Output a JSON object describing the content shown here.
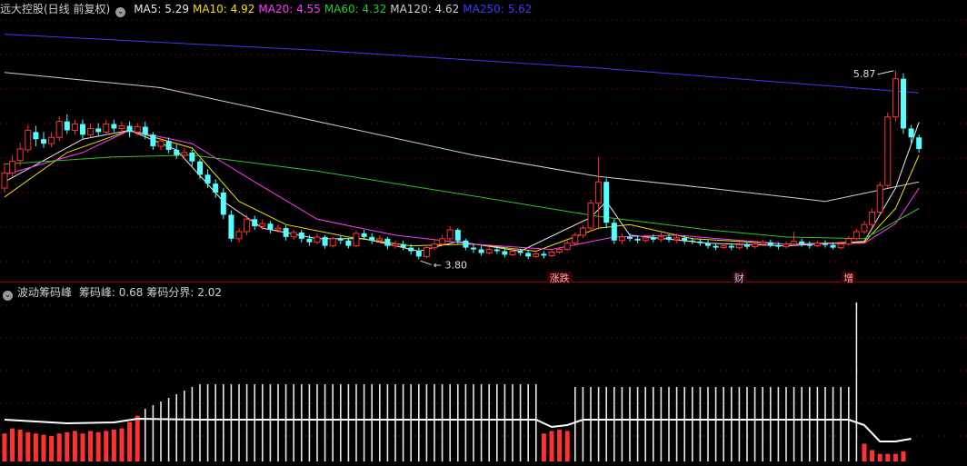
{
  "stock": {
    "title": "远大控股(日线 前复权)",
    "ma_items": [
      {
        "label": "MA5: ",
        "value": "5.29",
        "color": "#e8e8e8"
      },
      {
        "label": "MA10: ",
        "value": "4.92",
        "color": "#f0e000"
      },
      {
        "label": "MA20: ",
        "value": "4.55",
        "color": "#ff3cff"
      },
      {
        "label": "MA60: ",
        "value": "4.32",
        "color": "#28c828"
      },
      {
        "label": "MA120: ",
        "value": "4.62",
        "color": "#d0d0d0"
      },
      {
        "label": "MA250: ",
        "value": "5.62",
        "color": "#3a3aff"
      }
    ],
    "max_label": "5.87",
    "min_label": "3.80",
    "event_tags": [
      "涨跌",
      "财",
      "增"
    ],
    "colors": {
      "up": "#ff3232",
      "down": "#54ffff",
      "bg": "#000000",
      "grid": "#6a0000"
    }
  },
  "indicator": {
    "title": "波动筹码峰",
    "items": [
      {
        "label": "筹码峰: ",
        "value": "0.68"
      },
      {
        "label": "筹码分界: ",
        "value": "2.02"
      }
    ]
  },
  "icons": {
    "main_toggle": "chevron-down-icon",
    "sub_toggle": "chevron-down-icon"
  },
  "chart_data": {
    "type": "candlestick",
    "ylim": [
      3.6,
      6.4
    ],
    "candles": [
      [
        4.55,
        4.72,
        4.83,
        4.5
      ],
      [
        4.72,
        4.85,
        4.92,
        4.68
      ],
      [
        4.86,
        4.99,
        5.06,
        4.8
      ],
      [
        4.98,
        5.2,
        5.26,
        4.95
      ],
      [
        5.18,
        5.1,
        5.25,
        5.02
      ],
      [
        5.1,
        5.05,
        5.18,
        5.0
      ],
      [
        5.05,
        5.12,
        5.18,
        5.01
      ],
      [
        5.12,
        5.3,
        5.36,
        5.08
      ],
      [
        5.3,
        5.2,
        5.38,
        5.16
      ],
      [
        5.2,
        5.27,
        5.32,
        5.15
      ],
      [
        5.27,
        5.15,
        5.32,
        5.1
      ],
      [
        5.15,
        5.22,
        5.28,
        5.12
      ],
      [
        5.22,
        5.18,
        5.28,
        5.14
      ],
      [
        5.18,
        5.27,
        5.32,
        5.15
      ],
      [
        5.27,
        5.22,
        5.32,
        5.18
      ],
      [
        5.22,
        5.25,
        5.3,
        5.18
      ],
      [
        5.25,
        5.18,
        5.3,
        5.12
      ],
      [
        5.18,
        5.24,
        5.28,
        5.14
      ],
      [
        5.24,
        5.15,
        5.3,
        5.1
      ],
      [
        5.15,
        5.02,
        5.18,
        4.98
      ],
      [
        5.02,
        5.08,
        5.12,
        4.98
      ],
      [
        5.08,
        4.98,
        5.12,
        4.94
      ],
      [
        4.98,
        4.92,
        5.04,
        4.88
      ],
      [
        4.92,
        4.95,
        5.0,
        4.88
      ],
      [
        4.95,
        4.85,
        4.98,
        4.8
      ],
      [
        4.85,
        4.7,
        4.88,
        4.65
      ],
      [
        4.7,
        4.6,
        4.76,
        4.55
      ],
      [
        4.6,
        4.5,
        4.65,
        4.44
      ],
      [
        4.5,
        4.25,
        4.55,
        4.2
      ],
      [
        4.25,
        3.98,
        4.3,
        3.95
      ],
      [
        3.98,
        4.06,
        4.1,
        3.94
      ],
      [
        4.06,
        4.2,
        4.25,
        4.02
      ],
      [
        4.2,
        4.12,
        4.24,
        4.08
      ],
      [
        4.12,
        4.15,
        4.2,
        4.08
      ],
      [
        4.15,
        4.08,
        4.18,
        4.04
      ],
      [
        4.08,
        4.1,
        4.14,
        4.05
      ],
      [
        4.1,
        4.0,
        4.13,
        3.96
      ],
      [
        4.0,
        4.05,
        4.08,
        3.97
      ],
      [
        4.05,
        3.98,
        4.08,
        3.94
      ],
      [
        3.98,
        3.94,
        4.02,
        3.9
      ],
      [
        3.94,
        4.0,
        4.04,
        3.92
      ],
      [
        4.0,
        3.9,
        4.02,
        3.87
      ],
      [
        3.9,
        3.98,
        4.0,
        3.88
      ],
      [
        3.98,
        3.96,
        4.02,
        3.92
      ],
      [
        3.96,
        3.9,
        3.99,
        3.87
      ],
      [
        3.9,
        4.04,
        4.07,
        3.88
      ],
      [
        4.04,
        4.0,
        4.08,
        3.97
      ],
      [
        4.0,
        3.96,
        4.04,
        3.92
      ],
      [
        3.96,
        3.98,
        4.02,
        3.93
      ],
      [
        3.98,
        3.9,
        4.0,
        3.86
      ],
      [
        3.9,
        3.92,
        3.96,
        3.87
      ],
      [
        3.92,
        3.88,
        3.96,
        3.85
      ],
      [
        3.88,
        3.84,
        3.92,
        3.8
      ],
      [
        3.84,
        3.78,
        3.88,
        3.75
      ],
      [
        3.78,
        3.88,
        3.91,
        3.76
      ],
      [
        3.88,
        3.92,
        3.96,
        3.85
      ],
      [
        3.92,
        3.98,
        4.02,
        3.9
      ],
      [
        3.98,
        4.08,
        4.12,
        3.96
      ],
      [
        4.08,
        3.96,
        4.1,
        3.92
      ],
      [
        3.96,
        3.88,
        3.98,
        3.85
      ],
      [
        3.88,
        3.86,
        3.92,
        3.82
      ],
      [
        3.86,
        3.82,
        3.9,
        3.79
      ],
      [
        3.82,
        3.86,
        3.89,
        3.8
      ],
      [
        3.86,
        3.84,
        3.89,
        3.81
      ],
      [
        3.84,
        3.8,
        3.87,
        3.77
      ],
      [
        3.8,
        3.84,
        3.88,
        3.78
      ],
      [
        3.84,
        3.82,
        3.87,
        3.79
      ],
      [
        3.82,
        3.78,
        3.85,
        3.75
      ],
      [
        3.78,
        3.81,
        3.84,
        3.76
      ],
      [
        3.81,
        3.79,
        3.84,
        3.76
      ],
      [
        3.79,
        3.83,
        3.86,
        3.77
      ],
      [
        3.83,
        3.86,
        3.89,
        3.81
      ],
      [
        3.86,
        3.93,
        3.96,
        3.84
      ],
      [
        3.93,
        4.02,
        4.05,
        3.9
      ],
      [
        4.02,
        4.1,
        4.13,
        3.99
      ],
      [
        4.1,
        4.38,
        4.42,
        4.06
      ],
      [
        4.38,
        4.62,
        4.9,
        4.1
      ],
      [
        4.62,
        4.16,
        4.66,
        4.1
      ],
      [
        4.16,
        3.96,
        4.2,
        3.92
      ],
      [
        3.96,
        4.0,
        4.04,
        3.92
      ],
      [
        4.0,
        3.98,
        4.04,
        3.95
      ],
      [
        3.98,
        3.96,
        4.02,
        3.93
      ],
      [
        3.96,
        3.99,
        4.03,
        3.94
      ],
      [
        3.99,
        3.97,
        4.03,
        3.94
      ],
      [
        3.97,
        4.0,
        4.05,
        3.94
      ],
      [
        4.0,
        3.97,
        4.03,
        3.94
      ],
      [
        3.97,
        3.99,
        4.04,
        3.93
      ],
      [
        3.99,
        3.96,
        4.02,
        3.92
      ],
      [
        3.96,
        3.95,
        3.99,
        3.92
      ],
      [
        3.95,
        3.93,
        3.98,
        3.9
      ],
      [
        3.93,
        3.9,
        3.96,
        3.87
      ],
      [
        3.9,
        3.88,
        3.93,
        3.85
      ],
      [
        3.88,
        3.9,
        3.93,
        3.86
      ],
      [
        3.9,
        3.88,
        3.93,
        3.85
      ],
      [
        3.88,
        3.91,
        3.94,
        3.86
      ],
      [
        3.91,
        3.89,
        3.94,
        3.86
      ],
      [
        3.89,
        3.92,
        3.95,
        3.87
      ],
      [
        3.92,
        3.94,
        3.97,
        3.9
      ],
      [
        3.94,
        3.91,
        3.97,
        3.88
      ],
      [
        3.91,
        3.89,
        3.94,
        3.86
      ],
      [
        3.89,
        3.92,
        3.95,
        3.87
      ],
      [
        3.92,
        3.95,
        4.06,
        3.9
      ],
      [
        3.95,
        3.92,
        3.98,
        3.89
      ],
      [
        3.92,
        3.9,
        3.95,
        3.87
      ],
      [
        3.9,
        3.93,
        3.96,
        3.88
      ],
      [
        3.93,
        3.91,
        3.96,
        3.88
      ],
      [
        3.91,
        3.88,
        3.94,
        3.86
      ],
      [
        3.88,
        3.92,
        3.95,
        3.86
      ],
      [
        3.92,
        3.98,
        4.01,
        3.9
      ],
      [
        3.98,
        4.06,
        4.09,
        3.96
      ],
      [
        4.06,
        4.14,
        4.18,
        4.03
      ],
      [
        4.14,
        4.28,
        4.32,
        4.11
      ],
      [
        4.28,
        4.58,
        4.62,
        4.25
      ],
      [
        4.58,
        5.35,
        5.4,
        4.55
      ],
      [
        5.35,
        5.78,
        5.87,
        5.3
      ],
      [
        5.78,
        5.22,
        5.84,
        5.16
      ],
      [
        5.22,
        5.12,
        5.26,
        5.05
      ],
      [
        5.12,
        4.99,
        5.15,
        4.95
      ]
    ],
    "ma_series": [
      {
        "name": "MA5",
        "points": [
          [
            0,
            4.62
          ],
          [
            10,
            5.1
          ],
          [
            16,
            5.2
          ],
          [
            22,
            4.98
          ],
          [
            28,
            4.4
          ],
          [
            33,
            4.1
          ],
          [
            40,
            3.98
          ],
          [
            46,
            3.98
          ],
          [
            53,
            3.84
          ],
          [
            58,
            3.95
          ],
          [
            66,
            3.84
          ],
          [
            75,
            4.22
          ],
          [
            77,
            4.4
          ],
          [
            80,
            4.02
          ],
          [
            90,
            3.93
          ],
          [
            100,
            3.9
          ],
          [
            110,
            3.95
          ],
          [
            114,
            4.55
          ],
          [
            117,
            5.29
          ]
        ]
      },
      {
        "name": "MA10",
        "points": [
          [
            0,
            4.45
          ],
          [
            8,
            4.95
          ],
          [
            16,
            5.2
          ],
          [
            24,
            5.0
          ],
          [
            30,
            4.4
          ],
          [
            36,
            4.14
          ],
          [
            44,
            4.0
          ],
          [
            52,
            3.9
          ],
          [
            60,
            3.92
          ],
          [
            68,
            3.84
          ],
          [
            76,
            4.1
          ],
          [
            80,
            4.14
          ],
          [
            88,
            3.98
          ],
          [
            100,
            3.92
          ],
          [
            110,
            3.94
          ],
          [
            114,
            4.32
          ],
          [
            117,
            4.92
          ]
        ]
      },
      {
        "name": "MA20",
        "points": [
          [
            0,
            4.7
          ],
          [
            10,
            4.95
          ],
          [
            16,
            5.2
          ],
          [
            24,
            5.05
          ],
          [
            32,
            4.62
          ],
          [
            40,
            4.2
          ],
          [
            50,
            4.02
          ],
          [
            60,
            3.92
          ],
          [
            70,
            3.86
          ],
          [
            78,
            4.0
          ],
          [
            86,
            4.02
          ],
          [
            100,
            3.92
          ],
          [
            110,
            3.93
          ],
          [
            114,
            4.15
          ],
          [
            117,
            4.55
          ]
        ]
      },
      {
        "name": "MA60",
        "points": [
          [
            0,
            4.82
          ],
          [
            14,
            4.9
          ],
          [
            24,
            4.92
          ],
          [
            40,
            4.74
          ],
          [
            60,
            4.46
          ],
          [
            76,
            4.23
          ],
          [
            90,
            4.08
          ],
          [
            100,
            4.0
          ],
          [
            110,
            3.98
          ],
          [
            117,
            4.32
          ]
        ]
      },
      {
        "name": "MA120",
        "points": [
          [
            0,
            5.85
          ],
          [
            20,
            5.68
          ],
          [
            40,
            5.3
          ],
          [
            60,
            4.92
          ],
          [
            76,
            4.68
          ],
          [
            90,
            4.55
          ],
          [
            105,
            4.4
          ],
          [
            117,
            4.62
          ]
        ]
      },
      {
        "name": "MA250",
        "points": [
          [
            0,
            6.28
          ],
          [
            40,
            6.1
          ],
          [
            76,
            5.9
          ],
          [
            117,
            5.62
          ]
        ]
      }
    ],
    "chip_lower": [
      {
        "from": 0,
        "to": 17,
        "values": [
          0.22,
          0.26,
          0.25,
          0.23,
          0.22,
          0.21,
          0.2,
          0.22,
          0.23,
          0.24,
          0.22,
          0.24,
          0.23,
          0.24,
          0.25,
          0.26,
          0.31,
          0.36
        ]
      },
      {
        "from": 69,
        "to": 72,
        "values": [
          0.22,
          0.24,
          0.25,
          0.24
        ]
      },
      {
        "from": 110,
        "to": 115,
        "values": [
          0.14,
          0.09,
          0.06,
          0.06,
          0.06,
          0.08
        ]
      }
    ],
    "chip_upper": [
      {
        "from": 18,
        "to": 68,
        "values": [
          0.58,
          0.62,
          0.66,
          0.7,
          0.74,
          0.78,
          0.82,
          0.85,
          0.85,
          0.85,
          0.85,
          0.85,
          0.85,
          0.85,
          0.85,
          0.85,
          0.85,
          0.85,
          0.85,
          0.85,
          0.85,
          0.85,
          0.85,
          0.85,
          0.85,
          0.85,
          0.85,
          0.85,
          0.85,
          0.85,
          0.85,
          0.85,
          0.85,
          0.85,
          0.85,
          0.85,
          0.85,
          0.85,
          0.85,
          0.85,
          0.85,
          0.85,
          0.85,
          0.85,
          0.85,
          0.85,
          0.85,
          0.85,
          0.85,
          0.85,
          0.85
        ]
      },
      {
        "from": 73,
        "to": 109,
        "values": [
          0.82,
          0.82,
          0.82,
          0.82,
          0.82,
          0.82,
          0.82,
          0.82,
          0.82,
          0.82,
          0.82,
          0.82,
          0.82,
          0.82,
          0.82,
          0.82,
          0.82,
          0.82,
          0.82,
          0.82,
          0.82,
          0.82,
          0.82,
          0.82,
          0.82,
          0.82,
          0.82,
          0.82,
          0.82,
          0.82,
          0.82,
          0.82,
          0.82,
          0.82,
          0.82,
          0.82,
          1.75
        ]
      }
    ],
    "chip_line": [
      [
        0,
        0.46
      ],
      [
        8,
        0.42
      ],
      [
        14,
        0.43
      ],
      [
        17,
        0.47
      ],
      [
        25,
        0.46
      ],
      [
        50,
        0.46
      ],
      [
        68,
        0.46
      ],
      [
        70,
        0.38
      ],
      [
        72,
        0.4
      ],
      [
        74,
        0.46
      ],
      [
        90,
        0.46
      ],
      [
        108,
        0.46
      ],
      [
        110,
        0.4
      ],
      [
        112,
        0.22
      ],
      [
        114,
        0.22
      ],
      [
        116,
        0.25
      ]
    ]
  }
}
